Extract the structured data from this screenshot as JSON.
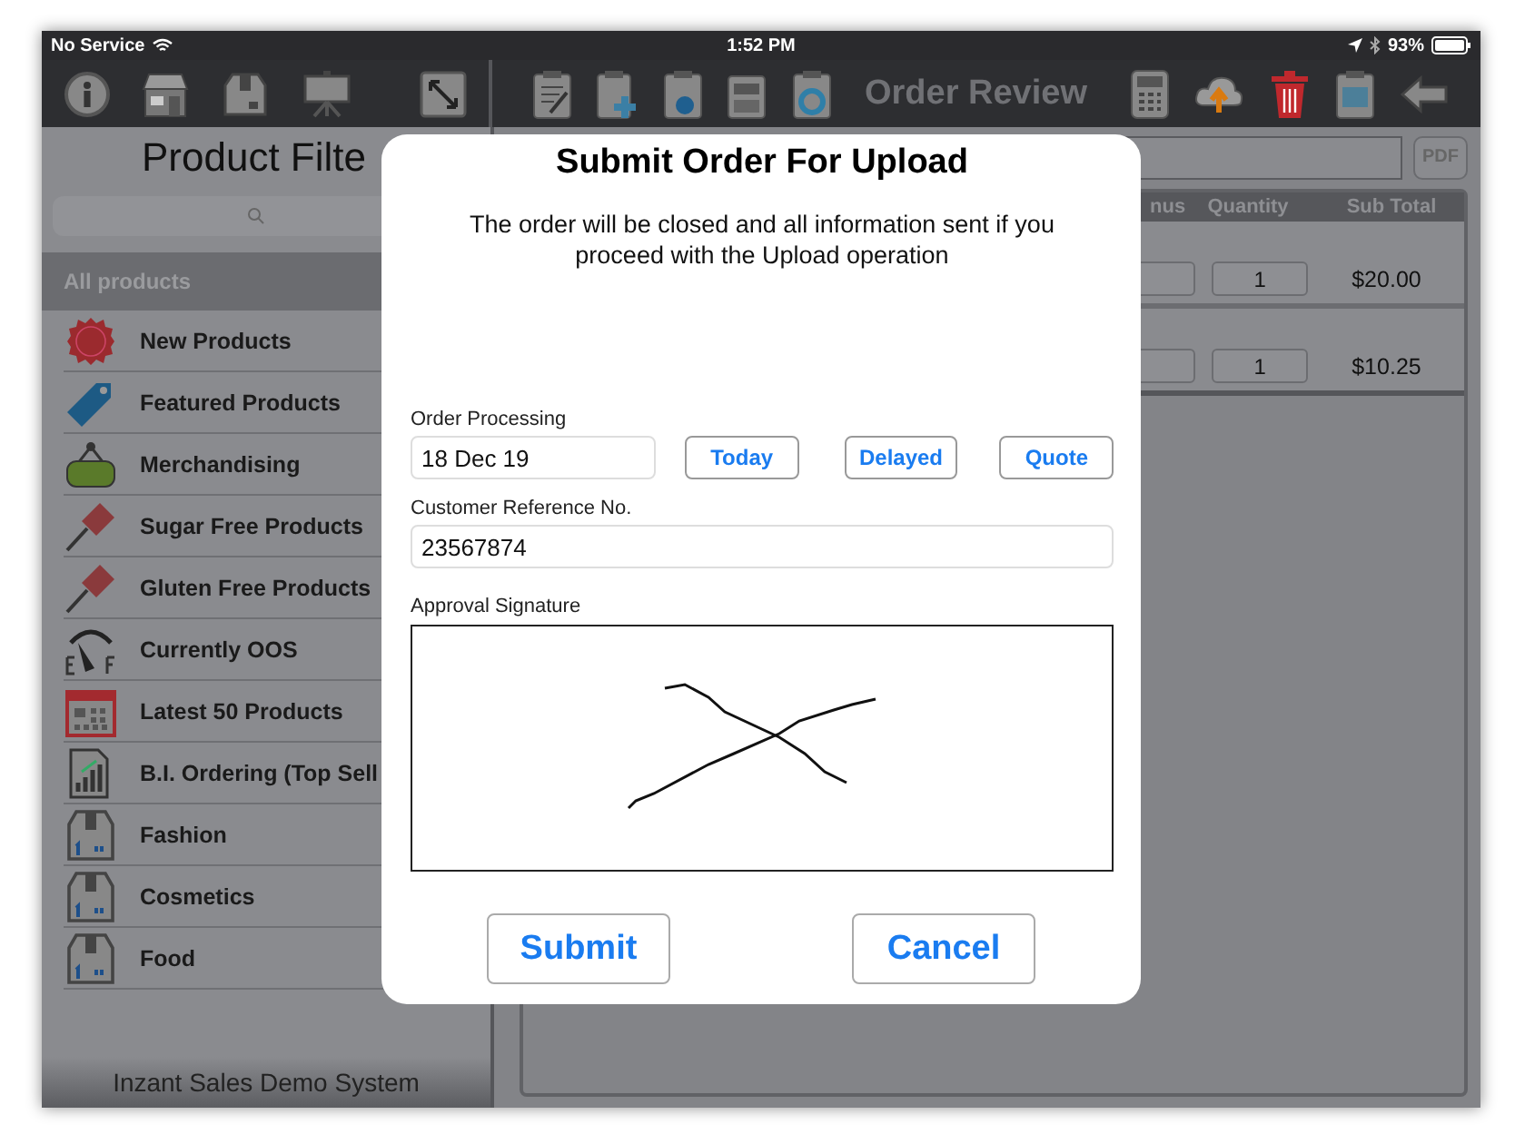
{
  "status_bar": {
    "carrier": "No Service",
    "time": "1:52 PM",
    "battery": "93%"
  },
  "toolbar": {
    "title": "Order Review"
  },
  "sidebar": {
    "title": "Product Filte",
    "section_header": "All products",
    "items": [
      {
        "label": "New Products"
      },
      {
        "label": "Featured Products"
      },
      {
        "label": "Merchandising"
      },
      {
        "label": "Sugar Free Products"
      },
      {
        "label": "Gluten Free Products"
      },
      {
        "label": "Currently OOS"
      },
      {
        "label": "Latest 50 Products"
      },
      {
        "label": "B.I. Ordering (Top Sell"
      },
      {
        "label": "Fashion"
      },
      {
        "label": "Cosmetics"
      },
      {
        "label": "Food"
      }
    ],
    "footer": "Inzant Sales Demo System"
  },
  "order": {
    "pdf_button": "PDF",
    "columns": [
      "nus",
      "Quantity",
      "Sub Total"
    ],
    "rows": [
      {
        "quantity": "1",
        "sub_total": "$20.00"
      },
      {
        "quantity": "1",
        "sub_total": "$10.25"
      }
    ]
  },
  "dialog": {
    "title": "Submit Order For Upload",
    "message": "The order will be closed and all information sent if you proceed with the Upload operation",
    "order_processing": {
      "label": "Order Processing",
      "value": "18 Dec 19",
      "options": [
        "Today",
        "Delayed",
        "Quote"
      ]
    },
    "customer_reference": {
      "label": "Customer Reference No.",
      "value": "23567874"
    },
    "signature": {
      "label": "Approval Signature"
    },
    "buttons": [
      "Submit",
      "Cancel"
    ]
  }
}
